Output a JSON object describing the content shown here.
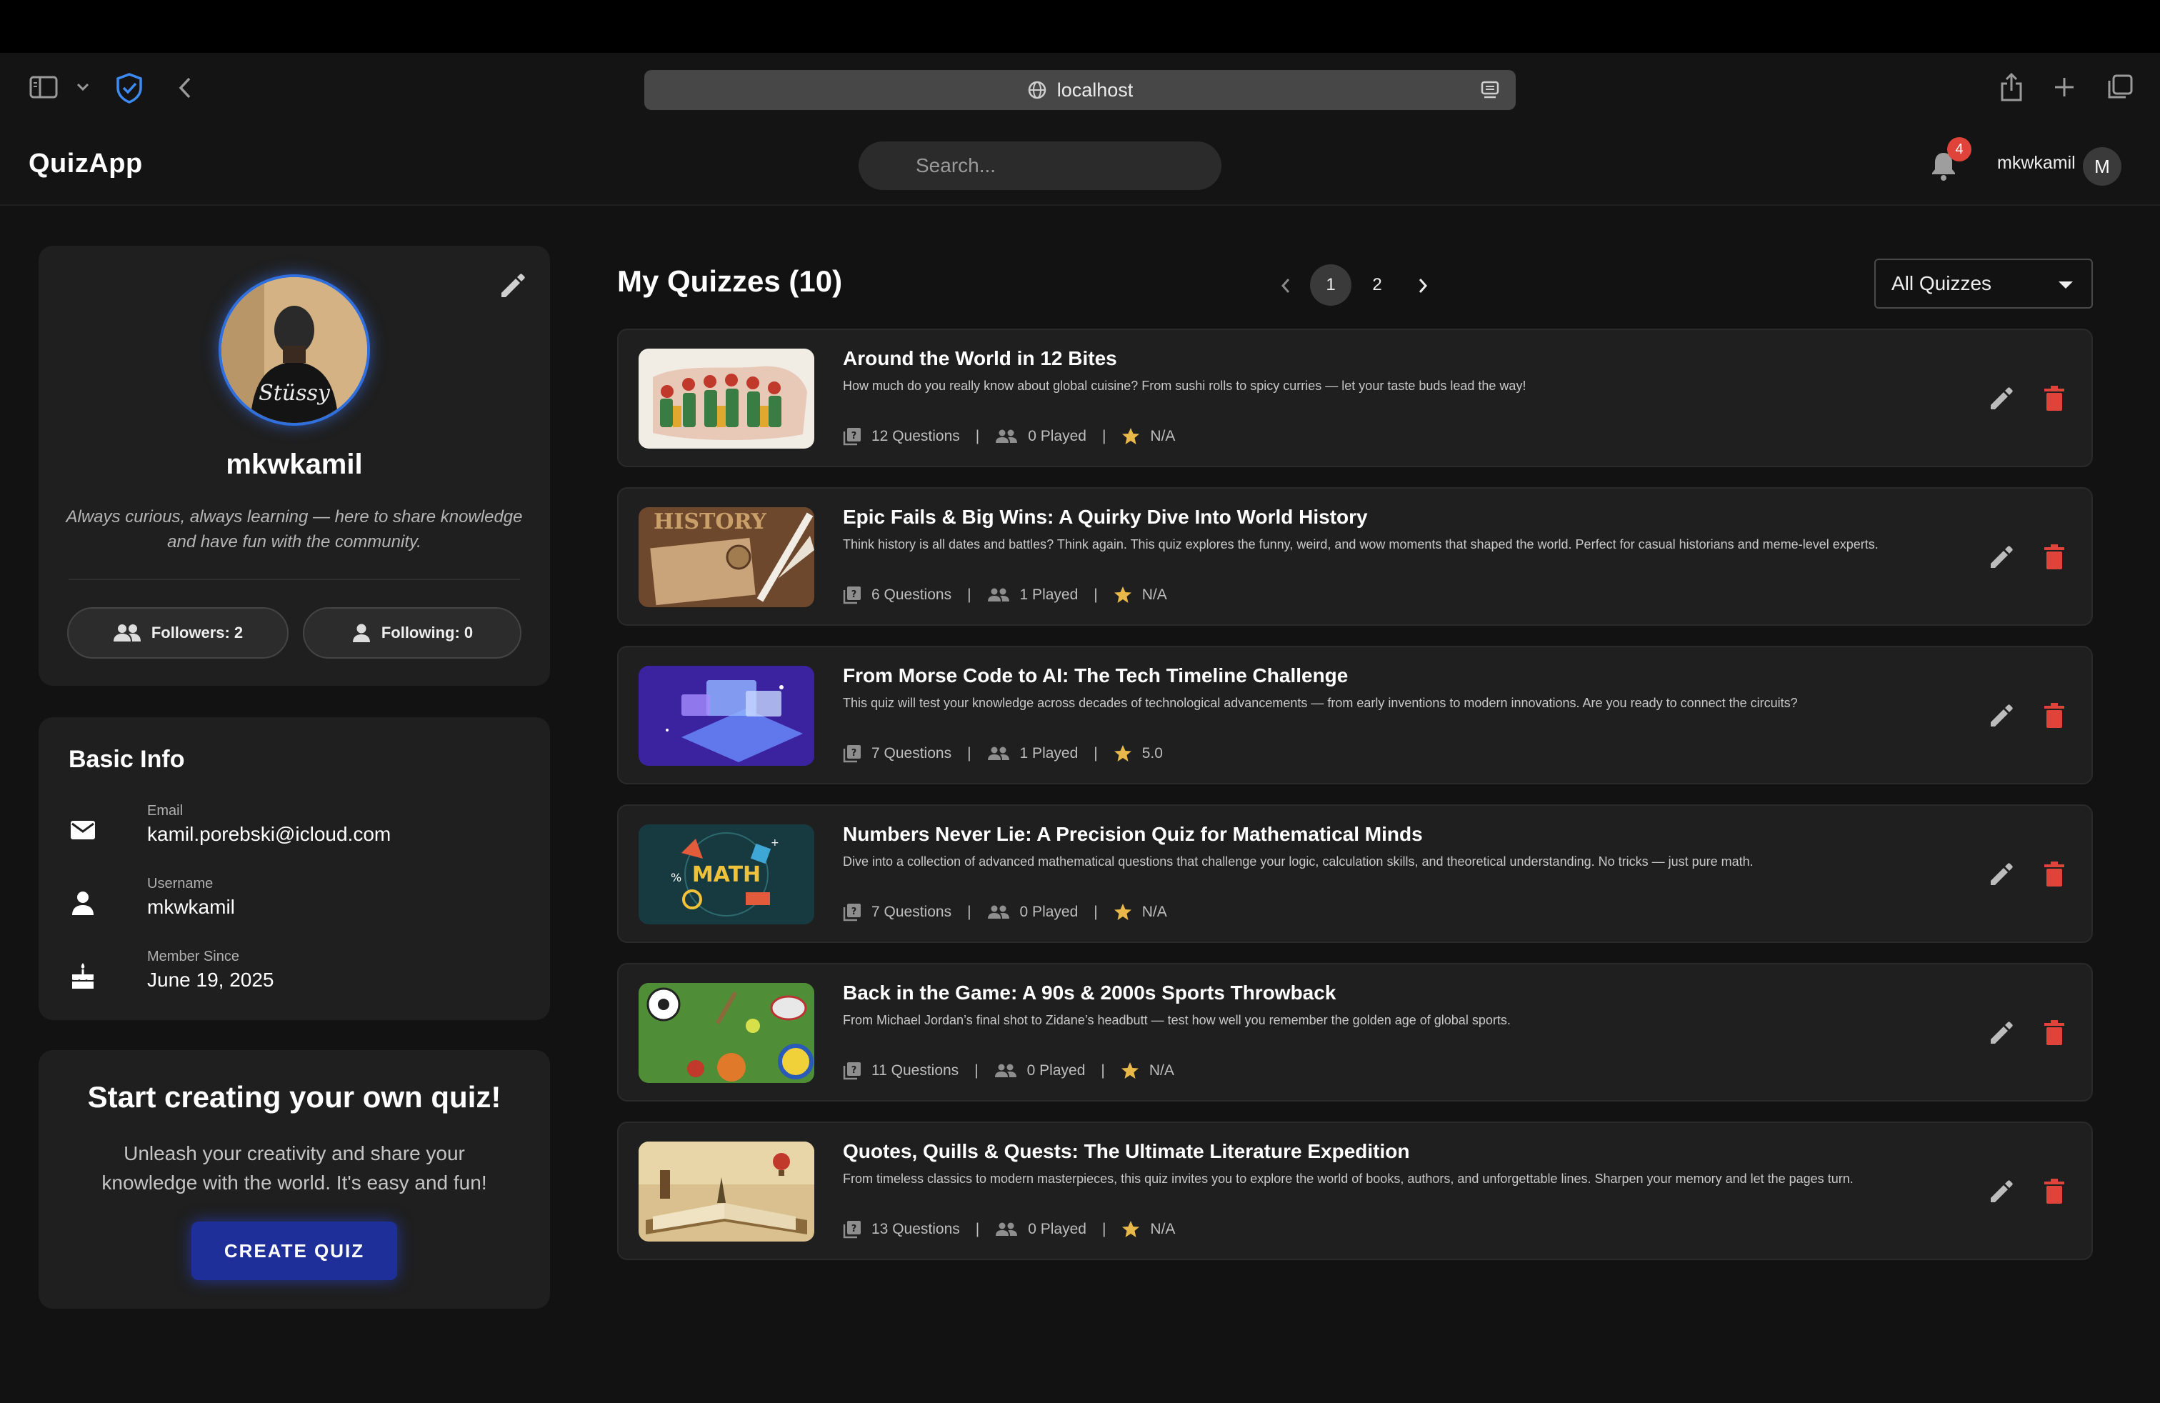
{
  "browser": {
    "url": "localhost",
    "icons": [
      "sidebar-icon",
      "chevron-down-icon",
      "shield-icon",
      "back-icon",
      "globe-icon",
      "reader-icon",
      "share-icon",
      "plus-icon",
      "tabs-icon"
    ]
  },
  "header": {
    "brand": "QuizApp",
    "search_placeholder": "Search...",
    "notification_count": "4",
    "username": "mkwkamil",
    "avatar_initial": "M"
  },
  "profile": {
    "name": "mkwkamil",
    "bio": "Always curious, always learning — here to share knowledge and have fun with the community.",
    "followers_label": "Followers: 2",
    "following_label": "Following: 0"
  },
  "basic_info": {
    "title": "Basic Info",
    "email_label": "Email",
    "email_value": "kamil.porebski@icloud.com",
    "username_label": "Username",
    "username_value": "mkwkamil",
    "member_label": "Member Since",
    "member_value": "June 19, 2025"
  },
  "cta": {
    "title": "Start creating your own quiz!",
    "text": "Unleash your creativity and share your knowledge with the world. It's easy and fun!",
    "button": "CREATE QUIZ"
  },
  "quizzes": {
    "title": "My Quizzes (10)",
    "pages": [
      "1",
      "2"
    ],
    "active_page": "1",
    "filter": "All Quizzes",
    "items": [
      {
        "title": "Around the World in 12 Bites",
        "description": "How much do you really know about global cuisine? From sushi rolls to spicy curries — let your taste buds lead the way!",
        "questions": "12 Questions",
        "played": "0 Played",
        "rating": "N/A"
      },
      {
        "title": "Epic Fails & Big Wins: A Quirky Dive Into World History",
        "description": "Think history is all dates and battles? Think again. This quiz explores the funny, weird, and wow moments that shaped the world. Perfect for casual historians and meme-level experts.",
        "questions": "6 Questions",
        "played": "1 Played",
        "rating": "N/A"
      },
      {
        "title": "From Morse Code to AI: The Tech Timeline Challenge",
        "description": "This quiz will test your knowledge across decades of technological advancements — from early inventions to modern innovations. Are you ready to connect the circuits?",
        "questions": "7 Questions",
        "played": "1 Played",
        "rating": "5.0"
      },
      {
        "title": "Numbers Never Lie: A Precision Quiz for Mathematical Minds",
        "description": "Dive into a collection of advanced mathematical questions that challenge your logic, calculation skills, and theoretical understanding. No tricks — just pure math.",
        "questions": "7 Questions",
        "played": "0 Played",
        "rating": "N/A"
      },
      {
        "title": "Back in the Game: A 90s & 2000s Sports Throwback",
        "description": "From Michael Jordan’s final shot to Zidane’s headbutt — test how well you remember the golden age of global sports.",
        "questions": "11 Questions",
        "played": "0 Played",
        "rating": "N/A"
      },
      {
        "title": "Quotes, Quills & Quests: The Ultimate Literature Expedition",
        "description": "From timeless classics to modern masterpieces, this quiz invites you to explore the world of books, authors, and unforgettable lines. Sharpen your memory and let the pages turn.",
        "questions": "13 Questions",
        "played": "0 Played",
        "rating": "N/A"
      }
    ]
  },
  "colors": {
    "background": "#121212",
    "card": "#1f1f1f",
    "accent_blue": "#1f2f9a",
    "delete_red": "#e0433a",
    "star": "#e8b84a"
  }
}
